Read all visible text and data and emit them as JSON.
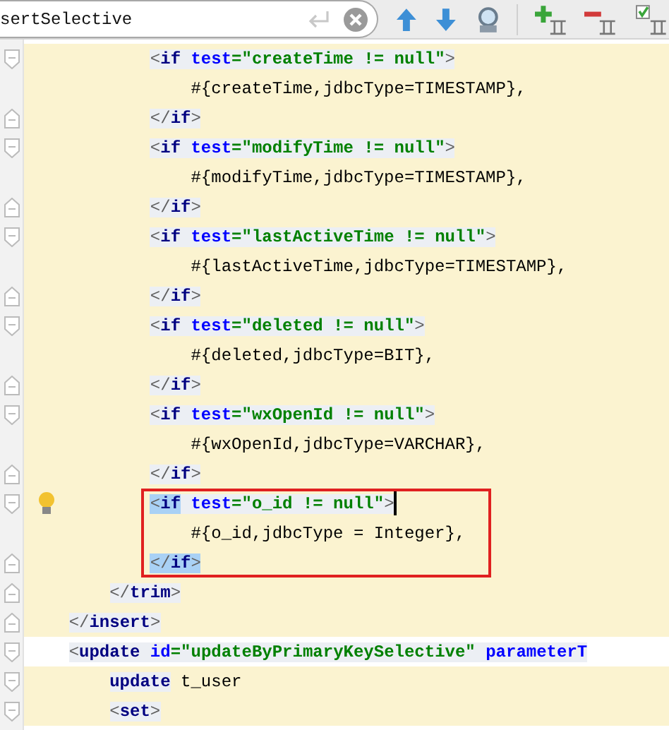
{
  "search": {
    "value": "sertSelective"
  },
  "lines": [
    {
      "fold_open": true,
      "fold_close": false,
      "scope": true,
      "caret": false,
      "bulb": false,
      "boxed": false,
      "segments": [
        {
          "t": "            <",
          "kind": "bracket"
        },
        {
          "t": "if",
          "kind": "name"
        },
        {
          "t": " test",
          "kind": "attr"
        },
        {
          "t": "=\"createTime != null\"",
          "kind": "value"
        },
        {
          "t": ">",
          "kind": "bracket"
        }
      ]
    },
    {
      "fold_open": false,
      "fold_close": false,
      "scope": true,
      "caret": false,
      "bulb": false,
      "boxed": false,
      "segments": [
        {
          "t": "                #{createTime,jdbcType=TIMESTAMP},",
          "kind": "text"
        }
      ]
    },
    {
      "fold_open": false,
      "fold_close": true,
      "scope": true,
      "caret": false,
      "bulb": false,
      "boxed": false,
      "segments": [
        {
          "t": "            </",
          "kind": "bracket"
        },
        {
          "t": "if",
          "kind": "name"
        },
        {
          "t": ">",
          "kind": "bracket"
        }
      ]
    },
    {
      "fold_open": true,
      "fold_close": false,
      "scope": true,
      "caret": false,
      "bulb": false,
      "boxed": false,
      "segments": [
        {
          "t": "            <",
          "kind": "bracket"
        },
        {
          "t": "if",
          "kind": "name"
        },
        {
          "t": " test",
          "kind": "attr"
        },
        {
          "t": "=\"modifyTime != null\"",
          "kind": "value"
        },
        {
          "t": ">",
          "kind": "bracket"
        }
      ]
    },
    {
      "fold_open": false,
      "fold_close": false,
      "scope": true,
      "caret": false,
      "bulb": false,
      "boxed": false,
      "segments": [
        {
          "t": "                #{modifyTime,jdbcType=TIMESTAMP},",
          "kind": "text"
        }
      ]
    },
    {
      "fold_open": false,
      "fold_close": true,
      "scope": true,
      "caret": false,
      "bulb": false,
      "boxed": false,
      "segments": [
        {
          "t": "            </",
          "kind": "bracket"
        },
        {
          "t": "if",
          "kind": "name"
        },
        {
          "t": ">",
          "kind": "bracket"
        }
      ]
    },
    {
      "fold_open": true,
      "fold_close": false,
      "scope": true,
      "caret": false,
      "bulb": false,
      "boxed": false,
      "segments": [
        {
          "t": "            <",
          "kind": "bracket"
        },
        {
          "t": "if",
          "kind": "name"
        },
        {
          "t": " test",
          "kind": "attr"
        },
        {
          "t": "=\"lastActiveTime != null\"",
          "kind": "value"
        },
        {
          "t": ">",
          "kind": "bracket"
        }
      ]
    },
    {
      "fold_open": false,
      "fold_close": false,
      "scope": true,
      "caret": false,
      "bulb": false,
      "boxed": false,
      "segments": [
        {
          "t": "                #{lastActiveTime,jdbcType=TIMESTAMP},",
          "kind": "text"
        }
      ]
    },
    {
      "fold_open": false,
      "fold_close": true,
      "scope": true,
      "caret": false,
      "bulb": false,
      "boxed": false,
      "segments": [
        {
          "t": "            </",
          "kind": "bracket"
        },
        {
          "t": "if",
          "kind": "name"
        },
        {
          "t": ">",
          "kind": "bracket"
        }
      ]
    },
    {
      "fold_open": true,
      "fold_close": false,
      "scope": true,
      "caret": false,
      "bulb": false,
      "boxed": false,
      "segments": [
        {
          "t": "            <",
          "kind": "bracket"
        },
        {
          "t": "if",
          "kind": "name"
        },
        {
          "t": " test",
          "kind": "attr"
        },
        {
          "t": "=\"deleted != null\"",
          "kind": "value"
        },
        {
          "t": ">",
          "kind": "bracket"
        }
      ]
    },
    {
      "fold_open": false,
      "fold_close": false,
      "scope": true,
      "caret": false,
      "bulb": false,
      "boxed": false,
      "segments": [
        {
          "t": "                #{deleted,jdbcType=BIT},",
          "kind": "text"
        }
      ]
    },
    {
      "fold_open": false,
      "fold_close": true,
      "scope": true,
      "caret": false,
      "bulb": false,
      "boxed": false,
      "segments": [
        {
          "t": "            </",
          "kind": "bracket"
        },
        {
          "t": "if",
          "kind": "name"
        },
        {
          "t": ">",
          "kind": "bracket"
        }
      ]
    },
    {
      "fold_open": true,
      "fold_close": false,
      "scope": true,
      "caret": false,
      "bulb": false,
      "boxed": false,
      "segments": [
        {
          "t": "            <",
          "kind": "bracket"
        },
        {
          "t": "if",
          "kind": "name"
        },
        {
          "t": " test",
          "kind": "attr"
        },
        {
          "t": "=\"wxOpenId != null\"",
          "kind": "value"
        },
        {
          "t": ">",
          "kind": "bracket"
        }
      ]
    },
    {
      "fold_open": false,
      "fold_close": false,
      "scope": true,
      "caret": false,
      "bulb": false,
      "boxed": false,
      "segments": [
        {
          "t": "                #{wxOpenId,jdbcType=VARCHAR},",
          "kind": "text"
        }
      ]
    },
    {
      "fold_open": false,
      "fold_close": true,
      "scope": true,
      "caret": false,
      "bulb": false,
      "boxed": false,
      "segments": [
        {
          "t": "            </",
          "kind": "bracket"
        },
        {
          "t": "if",
          "kind": "name"
        },
        {
          "t": ">",
          "kind": "bracket"
        }
      ]
    },
    {
      "fold_open": true,
      "fold_close": false,
      "scope": true,
      "caret": true,
      "bulb": true,
      "boxed": true,
      "segments": [
        {
          "t": "            <",
          "kind": "bracket-match"
        },
        {
          "t": "if",
          "kind": "name-match"
        },
        {
          "t": " test",
          "kind": "attr"
        },
        {
          "t": "=\"o_id != null\"",
          "kind": "value"
        },
        {
          "t": ">",
          "kind": "bracket"
        }
      ]
    },
    {
      "fold_open": false,
      "fold_close": false,
      "scope": true,
      "caret": false,
      "bulb": false,
      "boxed": true,
      "segments": [
        {
          "t": "                #{o_id,jdbcType = Integer},",
          "kind": "text"
        }
      ]
    },
    {
      "fold_open": false,
      "fold_close": true,
      "scope": true,
      "caret": false,
      "bulb": false,
      "boxed": true,
      "segments": [
        {
          "t": "            </",
          "kind": "bracket-match"
        },
        {
          "t": "if",
          "kind": "name-match"
        },
        {
          "t": ">",
          "kind": "bracket-match"
        }
      ]
    },
    {
      "fold_open": false,
      "fold_close": true,
      "scope": true,
      "caret": false,
      "bulb": false,
      "boxed": false,
      "segments": [
        {
          "t": "        </",
          "kind": "bracket"
        },
        {
          "t": "trim",
          "kind": "name"
        },
        {
          "t": ">",
          "kind": "bracket"
        }
      ]
    },
    {
      "fold_open": false,
      "fold_close": true,
      "scope": true,
      "caret": false,
      "bulb": false,
      "boxed": false,
      "segments": [
        {
          "t": "    </",
          "kind": "bracket"
        },
        {
          "t": "insert",
          "kind": "name"
        },
        {
          "t": ">",
          "kind": "bracket"
        }
      ]
    },
    {
      "fold_open": true,
      "fold_close": false,
      "scope": false,
      "caret": false,
      "bulb": false,
      "boxed": false,
      "segments": [
        {
          "t": "    <",
          "kind": "bracket"
        },
        {
          "t": "update",
          "kind": "name"
        },
        {
          "t": " id",
          "kind": "attr"
        },
        {
          "t": "=\"updateByPrimaryKeySelective\"",
          "kind": "value"
        },
        {
          "t": " parameterT",
          "kind": "attr"
        }
      ]
    },
    {
      "fold_open": true,
      "fold_close": false,
      "scope": true,
      "caret": false,
      "bulb": false,
      "boxed": false,
      "segments": [
        {
          "t": "        update",
          "kind": "name"
        },
        {
          "t": " t_user",
          "kind": "text"
        }
      ]
    },
    {
      "fold_open": true,
      "fold_close": false,
      "scope": true,
      "caret": false,
      "bulb": false,
      "boxed": false,
      "segments": [
        {
          "t": "        <",
          "kind": "bracket"
        },
        {
          "t": "set",
          "kind": "name"
        },
        {
          "t": ">",
          "kind": "bracket"
        }
      ]
    }
  ]
}
